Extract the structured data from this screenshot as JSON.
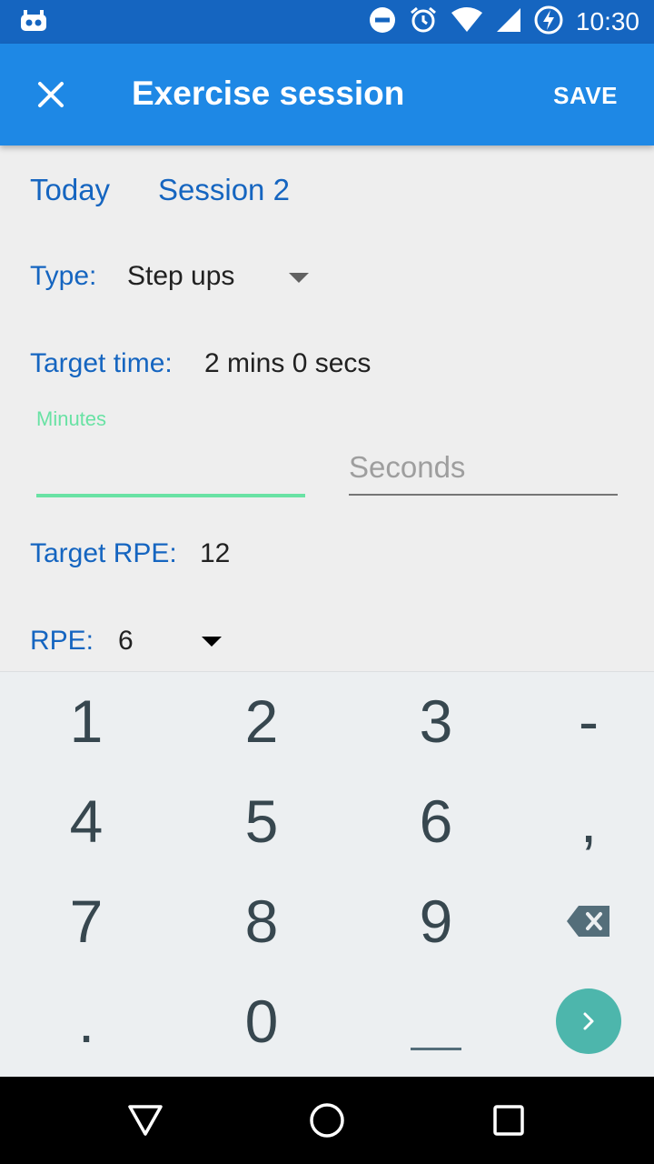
{
  "status_bar": {
    "time": "10:30"
  },
  "app_bar": {
    "title": "Exercise session",
    "save_label": "SAVE"
  },
  "session": {
    "day": "Today",
    "name": "Session 2"
  },
  "type_field": {
    "label": "Type:",
    "value": "Step ups"
  },
  "target_time": {
    "label": "Target time:",
    "value": "2 mins 0 secs"
  },
  "minutes_field": {
    "label": "Minutes",
    "value": ""
  },
  "seconds_field": {
    "placeholder": "Seconds",
    "value": ""
  },
  "target_rpe": {
    "label": "Target RPE:",
    "value": "12"
  },
  "rpe_field": {
    "label": "RPE:",
    "value": "6"
  },
  "keyboard": {
    "keys": [
      "1",
      "2",
      "3",
      "-",
      "4",
      "5",
      "6",
      ",",
      "7",
      "8",
      "9",
      "0",
      "."
    ]
  },
  "colors": {
    "accent": "#1e88e5",
    "status_bar": "#1565c0",
    "focus_line": "#69e2a4",
    "enter_key": "#4db6ac"
  }
}
